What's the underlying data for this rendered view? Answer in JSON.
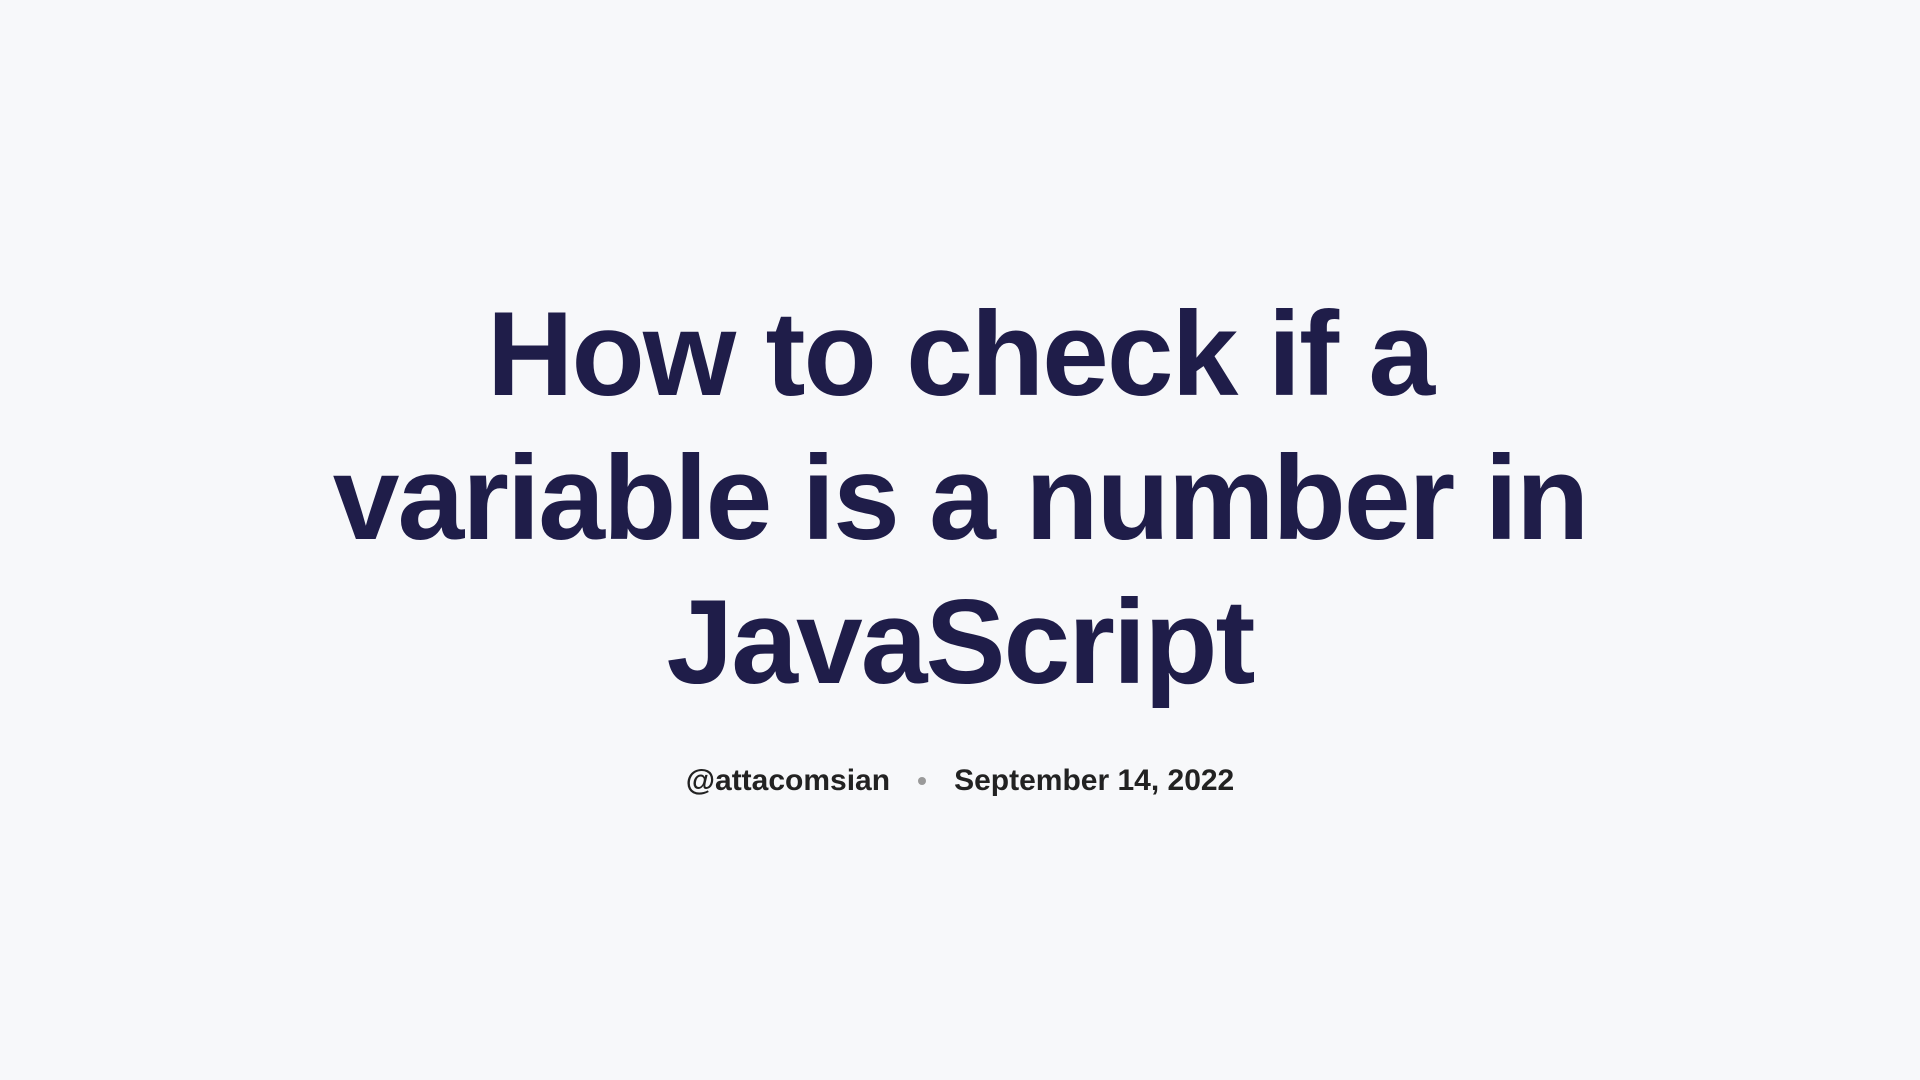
{
  "article": {
    "title": "How to check if a variable is a number in JavaScript",
    "author": "@attacomsian",
    "date": "September 14, 2022"
  }
}
